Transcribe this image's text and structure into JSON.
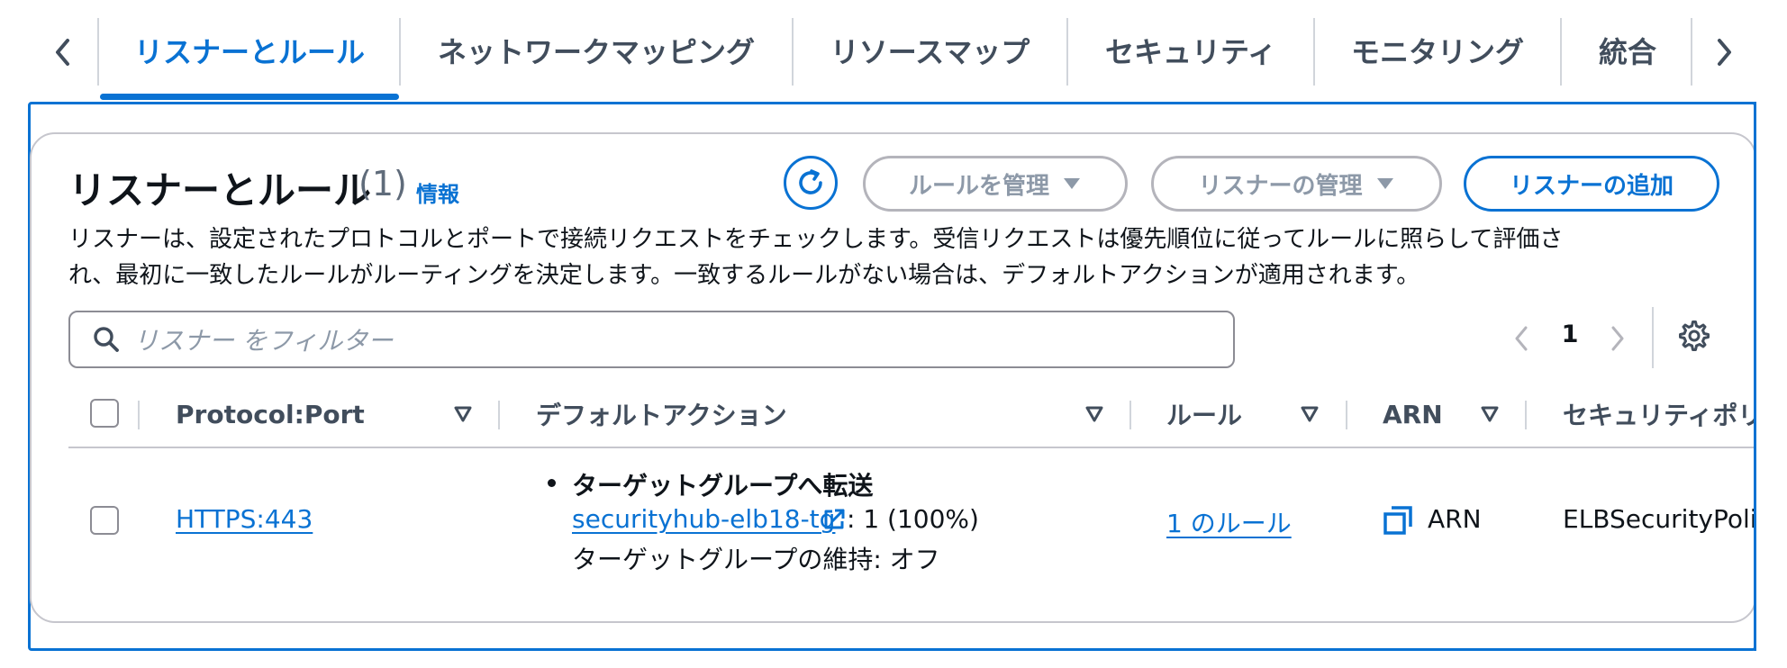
{
  "tabs": [
    {
      "label": "リスナーとルール",
      "active": true
    },
    {
      "label": "ネットワークマッピング",
      "active": false
    },
    {
      "label": "リソースマップ",
      "active": false
    },
    {
      "label": "セキュリティ",
      "active": false
    },
    {
      "label": "モニタリング",
      "active": false
    },
    {
      "label": "統合",
      "active": false
    }
  ],
  "panel": {
    "title": "リスナーとルール",
    "count": "(1)",
    "info_link": "情報",
    "manage_rules_label": "ルールを管理",
    "manage_listener_label": "リスナーの管理",
    "add_listener_label": "リスナーの追加",
    "description_line1": "リスナーは、設定されたプロトコルとポートで接続リクエストをチェックします。受信リクエストは優先順位に従ってルールに照らして評価さ",
    "description_line2": "れ、最初に一致したルールがルーティングを決定します。一致するルールがない場合は、デフォルトアクションが適用されます。"
  },
  "search": {
    "placeholder": "リスナー をフィルター"
  },
  "pagination": {
    "current_page": "1"
  },
  "table": {
    "columns": [
      "Protocol:Port",
      "デフォルトアクション",
      "ルール",
      "ARN",
      "セキュリティポリ"
    ],
    "rows": [
      {
        "protocol_port": "HTTPS:443",
        "action_title": "ターゲットグループへ転送",
        "target_group": "securityhub-elb18-tg",
        "target_weight": ": 1 (100%)",
        "stickiness": "ターゲットグループの維持: オフ",
        "rules": "1 のルール",
        "arn": "ARN",
        "security_policy": "ELBSecurityPolicy"
      }
    ]
  },
  "colors": {
    "accent": "#0972d3",
    "text": "#0f141a",
    "muted": "#414d5c",
    "disabled": "#8d99a8"
  }
}
